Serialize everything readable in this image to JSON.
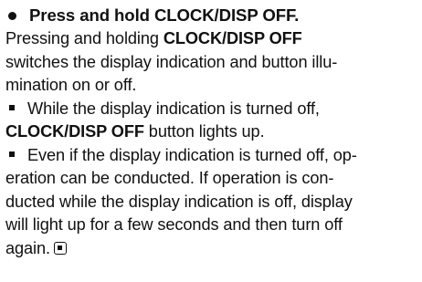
{
  "heading": {
    "text": "Press and hold CLOCK/DISP OFF."
  },
  "intro": {
    "line1_pre": "Pressing and holding ",
    "line1_bold": "CLOCK/DISP OFF",
    "line2": "switches the display indication and button illu-",
    "line3": "mination on or off."
  },
  "note1": {
    "line1": "While the display indication is turned off,",
    "line2_bold": "CLOCK/DISP OFF",
    "line2_post": " button lights up."
  },
  "note2": {
    "line1": "Even if the display indication is turned off, op-",
    "line2": "eration can be conducted. If operation is con-",
    "line3": "ducted while the display indication is off, display",
    "line4": "will light up for a few seconds and then turn off",
    "line5": "again."
  },
  "icons": {
    "heading_bullet": "filled-circle-icon",
    "note_bullet": "filled-square-icon",
    "end_of_section": "end-of-section-icon"
  }
}
